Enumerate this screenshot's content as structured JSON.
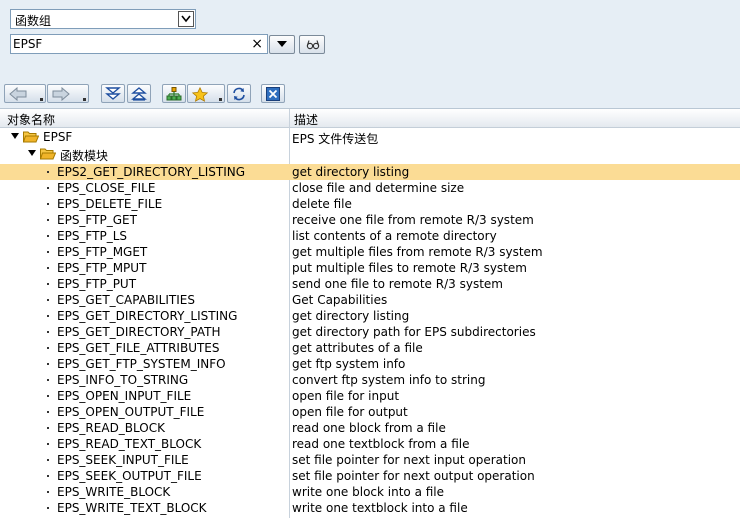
{
  "selector": {
    "value": "函数组"
  },
  "search": {
    "value": "EPSF",
    "clear_glyph": "×"
  },
  "header": {
    "col_name": "对象名称",
    "col_desc": "描述"
  },
  "tree_root": {
    "name": "EPSF",
    "desc": "EPS 文件传送包"
  },
  "tree_folder": {
    "name": "函数模块"
  },
  "selected_index": 0,
  "colors": {
    "selected_row": "#fbdc95",
    "folder": "#f0b429",
    "header_bg": "#e4e9ef"
  },
  "functions": [
    {
      "name": "EPS2_GET_DIRECTORY_LISTING",
      "desc": "get directory listing"
    },
    {
      "name": "EPS_CLOSE_FILE",
      "desc": "close file and determine size"
    },
    {
      "name": "EPS_DELETE_FILE",
      "desc": "delete file"
    },
    {
      "name": "EPS_FTP_GET",
      "desc": "receive one file from remote R/3 system"
    },
    {
      "name": "EPS_FTP_LS",
      "desc": "list contents of a remote directory"
    },
    {
      "name": "EPS_FTP_MGET",
      "desc": "get multiple files from remote R/3 system"
    },
    {
      "name": "EPS_FTP_MPUT",
      "desc": "put multiple files to remote R/3 system"
    },
    {
      "name": "EPS_FTP_PUT",
      "desc": "send one file to remote R/3 system"
    },
    {
      "name": "EPS_GET_CAPABILITIES",
      "desc": "Get Capabilities"
    },
    {
      "name": "EPS_GET_DIRECTORY_LISTING",
      "desc": "get directory listing"
    },
    {
      "name": "EPS_GET_DIRECTORY_PATH",
      "desc": "get directory path for EPS subdirectories"
    },
    {
      "name": "EPS_GET_FILE_ATTRIBUTES",
      "desc": "get attributes of a file"
    },
    {
      "name": "EPS_GET_FTP_SYSTEM_INFO",
      "desc": "get ftp system info"
    },
    {
      "name": "EPS_INFO_TO_STRING",
      "desc": "convert ftp system info to string"
    },
    {
      "name": "EPS_OPEN_INPUT_FILE",
      "desc": "open file for input"
    },
    {
      "name": "EPS_OPEN_OUTPUT_FILE",
      "desc": "open file for output"
    },
    {
      "name": "EPS_READ_BLOCK",
      "desc": "read one block from a file"
    },
    {
      "name": "EPS_READ_TEXT_BLOCK",
      "desc": "read one textblock from a file"
    },
    {
      "name": "EPS_SEEK_INPUT_FILE",
      "desc": "set file pointer for next input operation"
    },
    {
      "name": "EPS_SEEK_OUTPUT_FILE",
      "desc": "set file pointer for next output operation"
    },
    {
      "name": "EPS_WRITE_BLOCK",
      "desc": "write one block into a file"
    },
    {
      "name": "EPS_WRITE_TEXT_BLOCK",
      "desc": "write one textblock into a file"
    }
  ]
}
